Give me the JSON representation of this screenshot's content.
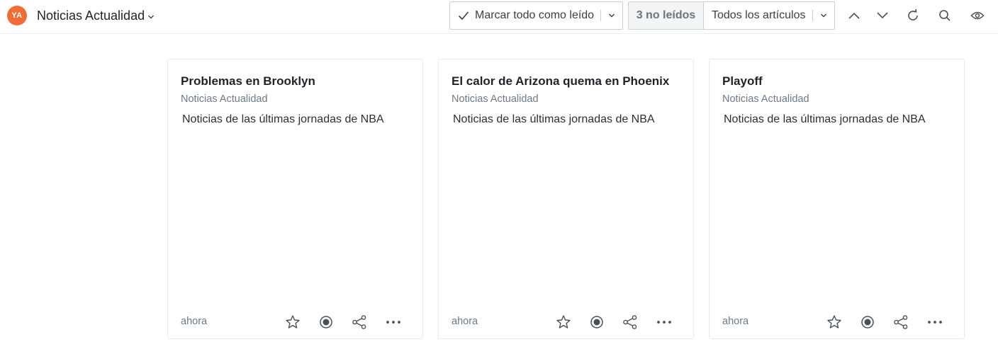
{
  "header": {
    "avatar_initials": "YA",
    "feed_title": "Noticias Actualidad",
    "mark_all_read_label": "Marcar todo como leído",
    "unread_count_label": "3 no leídos",
    "filter_label": "Todos los artículos",
    "icons": [
      "check-icon",
      "chevron-down-icon",
      "chevron-up-icon",
      "refresh-icon",
      "search-icon",
      "eye-icon"
    ]
  },
  "colors": {
    "avatar_bg": "#f26c37",
    "border": "#c9d0d6",
    "muted_text": "#6f7a85"
  },
  "cards": [
    {
      "title": "Problemas en Brooklyn",
      "source": "Noticias Actualidad",
      "description": "Noticias de las últimas jornadas de NBA",
      "time": "ahora"
    },
    {
      "title": "El calor de Arizona quema en Phoenix",
      "source": "Noticias Actualidad",
      "description": "Noticias de las últimas jornadas de NBA",
      "time": "ahora"
    },
    {
      "title": "Playoff",
      "source": "Noticias Actualidad",
      "description": "Noticias de las últimas jornadas de NBA",
      "time": "ahora"
    }
  ],
  "card_actions": [
    "star-icon",
    "mark-read-circle-icon",
    "share-icon",
    "more-options-icon"
  ]
}
